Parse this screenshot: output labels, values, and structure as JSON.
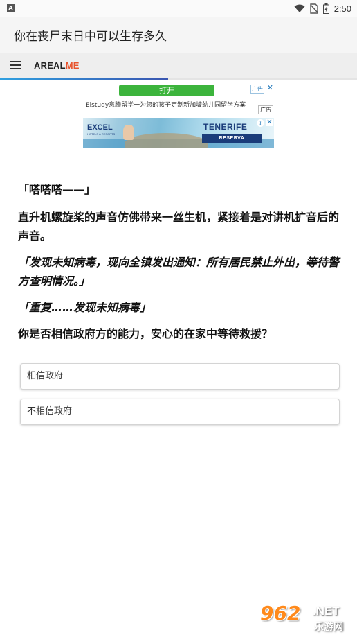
{
  "status_bar": {
    "app_badge": "A",
    "time": "2:50",
    "icons": [
      "wifi-icon",
      "no-sim-icon",
      "battery-icon"
    ]
  },
  "app_bar": {
    "title": "你在丧尸末日中可以生存多久"
  },
  "site_header": {
    "menu_icon": "hamburger-menu-icon",
    "logo_part1": "AREAL",
    "logo_part2": "ME",
    "logo_accent_color": "#e8542d",
    "reading_progress": 0.47
  },
  "ads": {
    "top": {
      "button_label": "打开",
      "tag": "广告",
      "close": "✕",
      "text": "Eistudy意腾留学一为您的孩子定制新加坡幼儿园留学方案"
    },
    "banner": {
      "tag": "广告",
      "brand": "EXCEL",
      "brand_sub": "HOTELS & RESORTS",
      "destination": "TENERIFE",
      "cta": "RESERVA",
      "info": "i",
      "close": "✕"
    }
  },
  "story": {
    "paragraphs": [
      "「嗒嗒嗒——」",
      "直升机螺旋桨的声音仿佛带来一丝生机，紧接着是对讲机扩音后的声音。",
      "「发现未知病毒，现向全镇发出通知：所有居民禁止外出，等待警方查明情况。」",
      "「重复……发现未知病毒」",
      "你是否相信政府方的能力，安心的在家中等待救援？"
    ]
  },
  "choices": [
    {
      "label": "相信政府"
    },
    {
      "label": "不相信政府"
    }
  ],
  "watermark": {
    "number": "962",
    "suffix": ".NET",
    "cn": "乐游网"
  }
}
